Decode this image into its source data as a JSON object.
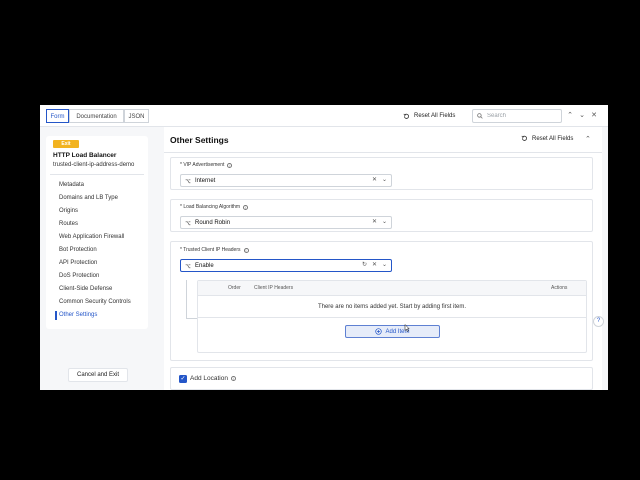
{
  "tabs": [
    {
      "label": "Form",
      "active": true
    },
    {
      "label": "Documentation",
      "active": false
    },
    {
      "label": "JSON",
      "active": false
    }
  ],
  "topbar": {
    "reset_all": "Reset All Fields",
    "search_placeholder": "Search",
    "prev_icon": "chevron-up-icon",
    "next_icon": "chevron-down-icon",
    "close_icon": "close-icon"
  },
  "sidebar": {
    "exit_label": "Exit",
    "title": "HTTP Load Balancer",
    "name": "trusted-client-ip-address-demo",
    "items": [
      {
        "label": "Metadata"
      },
      {
        "label": "Domains and LB Type"
      },
      {
        "label": "Origins"
      },
      {
        "label": "Routes"
      },
      {
        "label": "Web Application Firewall"
      },
      {
        "label": "Bot Protection"
      },
      {
        "label": "API Protection"
      },
      {
        "label": "DoS Protection"
      },
      {
        "label": "Client-Side Defense"
      },
      {
        "label": "Common Security Controls"
      },
      {
        "label": "Other Settings"
      }
    ],
    "active_index": 10,
    "cancel_label": "Cancel and Exit"
  },
  "main": {
    "title": "Other Settings",
    "reset_all": "Reset All Fields",
    "vip": {
      "label": "* VIP Advertisement",
      "value": "Internet"
    },
    "lb_algo": {
      "label": "* Load Balancing Algorithm",
      "value": "Round Robin"
    },
    "trusted": {
      "label": "* Trusted Client IP Headers",
      "value": "Enable",
      "table": {
        "headers": {
          "order": "Order",
          "client_ip": "Client IP Headers",
          "actions": "Actions"
        },
        "empty_message": "There are no items added yet. Start by adding first item.",
        "add_item_label": "Add Item"
      }
    },
    "add_location": {
      "label": "Add Location",
      "checked": true
    }
  },
  "colors": {
    "accent": "#2456c8",
    "exit_badge": "#f2b320",
    "background": "#f6f7f9"
  }
}
